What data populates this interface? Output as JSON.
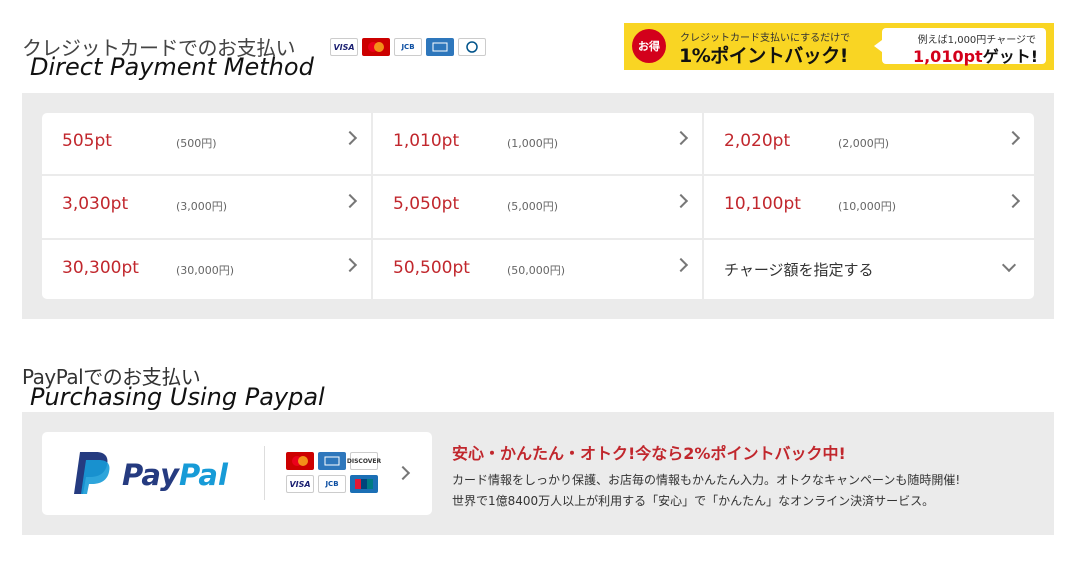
{
  "credit_card": {
    "title": "クレジットカードでのお支払い",
    "subtitle": "Direct Payment Method",
    "logos": [
      {
        "icon": "visa-logo",
        "label": "VISA"
      },
      {
        "icon": "mastercard-logo",
        "label": "MasterCard"
      },
      {
        "icon": "jcb-logo",
        "label": "JCB"
      },
      {
        "icon": "amex-logo",
        "label": "AMEX"
      },
      {
        "icon": "diners-logo",
        "label": "Diners Club"
      }
    ]
  },
  "promo": {
    "badge": "お得",
    "small_text": "クレジットカード支払いにするだけで",
    "big_text": "1%ポイントバック!",
    "bubble_small": "例えば1,000円チャージで",
    "bubble_pts": "1,010pt",
    "bubble_suffix": "ゲット!",
    "colors": {
      "background": "#f9d523",
      "badge": "#d3001b"
    }
  },
  "amounts": [
    {
      "points": "505pt",
      "yen": "(500円)"
    },
    {
      "points": "1,010pt",
      "yen": "(1,000円)"
    },
    {
      "points": "2,020pt",
      "yen": "(2,000円)"
    },
    {
      "points": "3,030pt",
      "yen": "(3,000円)"
    },
    {
      "points": "5,050pt",
      "yen": "(5,000円)"
    },
    {
      "points": "10,100pt",
      "yen": "(10,000円)"
    },
    {
      "points": "30,300pt",
      "yen": "(30,000円)"
    },
    {
      "points": "50,500pt",
      "yen": "(50,000円)"
    }
  ],
  "custom_amount_label": "チャージ額を指定する",
  "paypal": {
    "title": "PayPalでのお支払い",
    "subtitle": "Purchasing Using Paypal",
    "logo_text_1": "Pay",
    "logo_text_2": "Pal",
    "card_logos": [
      {
        "icon": "mastercard-logo",
        "label": "MC"
      },
      {
        "icon": "amex-logo",
        "label": "AMEX"
      },
      {
        "icon": "discover-logo",
        "label": "DISCOVER"
      },
      {
        "icon": "visa-logo",
        "label": "VISA"
      },
      {
        "icon": "jcb-logo",
        "label": "JCB"
      },
      {
        "icon": "unionpay-logo",
        "label": "UnionPay"
      }
    ],
    "headline": "安心・かんたん・オトク!今なら2%ポイントバック中!",
    "desc_line1": "カード情報をしっかり保護、お店毎の情報もかんたん入力。オトクなキャンペーンも随時開催!",
    "desc_line2": "世界で1億8400万人以上が利用する「安心」で「かんたん」なオンライン決済サービス。",
    "colors": {
      "pay": "#253b80",
      "pal": "#179bd7",
      "headline": "#c1272d"
    }
  }
}
